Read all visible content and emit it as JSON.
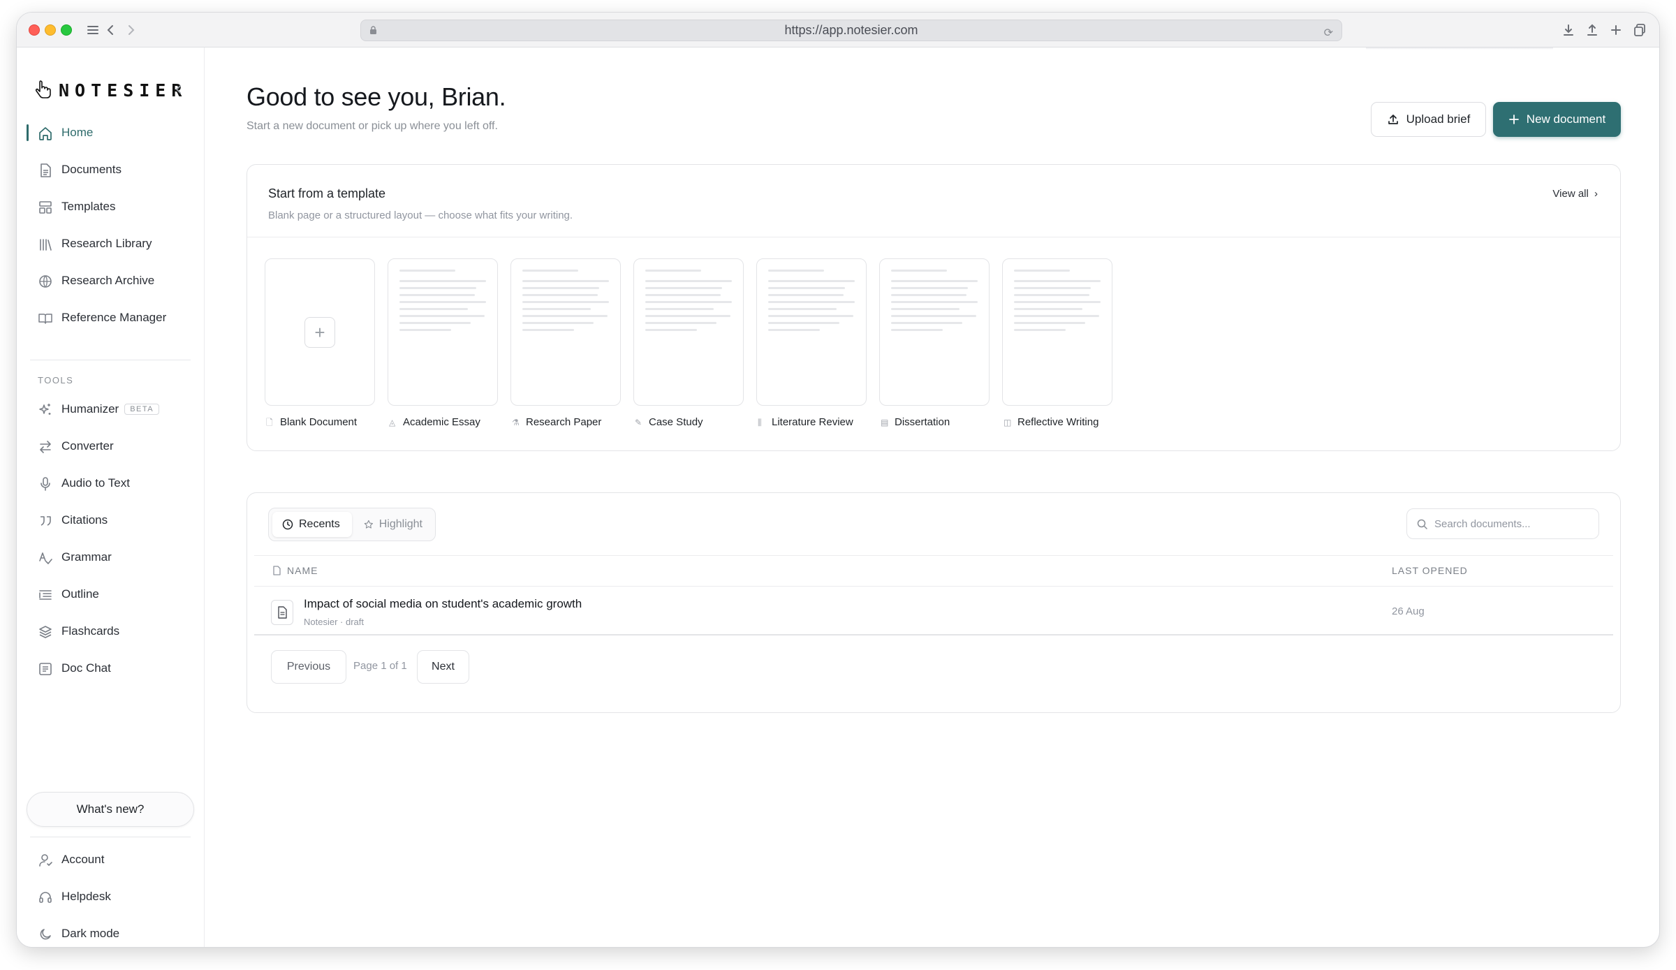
{
  "browser": {
    "url": "https://app.notesier.com"
  },
  "brand": {
    "name": "NOTESIER",
    "accent": "#2e6f72"
  },
  "sidebar": {
    "nav": [
      {
        "label": "Home",
        "icon": "home-icon",
        "active": true
      },
      {
        "label": "Documents",
        "icon": "document-icon"
      },
      {
        "label": "Templates",
        "icon": "templates-icon"
      },
      {
        "label": "Research Library",
        "icon": "library-icon"
      },
      {
        "label": "Research Archive",
        "icon": "globe-icon"
      },
      {
        "label": "Reference Manager",
        "icon": "book-open-icon"
      }
    ],
    "tools_label": "TOOLS",
    "tools": [
      {
        "label": "Humanizer",
        "icon": "sparkles-icon",
        "badge": "BETA"
      },
      {
        "label": "Converter",
        "icon": "arrows-swap-icon"
      },
      {
        "label": "Audio to Text",
        "icon": "microphone-icon"
      },
      {
        "label": "Citations",
        "icon": "quote-icon"
      },
      {
        "label": "Grammar",
        "icon": "spell-check-icon"
      },
      {
        "label": "Outline",
        "icon": "list-indent-icon"
      },
      {
        "label": "Flashcards",
        "icon": "layers-icon"
      },
      {
        "label": "Doc Chat",
        "icon": "chat-icon"
      }
    ],
    "whats_new": "What's new?",
    "bottom": [
      {
        "label": "Account",
        "icon": "user-icon"
      },
      {
        "label": "Helpdesk",
        "icon": "headset-icon"
      },
      {
        "label": "Dark mode",
        "icon": "moon-icon"
      }
    ]
  },
  "header": {
    "greeting": "Good to see you, Brian.",
    "subtitle": "Start a new document or pick up where you left off.",
    "upload_label": "Upload brief",
    "new_label": "New document"
  },
  "templates": {
    "title": "Start from a template",
    "subtitle": "Blank page or a structured layout — choose what fits your writing.",
    "view_all": "View all",
    "items": [
      {
        "label": "Blank Document",
        "icon": "file-icon"
      },
      {
        "label": "Academic Essay",
        "icon": "graduation-cap-icon"
      },
      {
        "label": "Research Paper",
        "icon": "flask-icon"
      },
      {
        "label": "Case Study",
        "icon": "edit-icon"
      },
      {
        "label": "Literature Review",
        "icon": "library-icon"
      },
      {
        "label": "Dissertation",
        "icon": "scroll-icon"
      },
      {
        "label": "Reflective Writing",
        "icon": "book-open-icon"
      }
    ]
  },
  "documents": {
    "tabs": [
      {
        "label": "Recents",
        "icon": "clock-icon",
        "active": true
      },
      {
        "label": "Highlight",
        "icon": "star-icon"
      }
    ],
    "search_placeholder": "Search documents...",
    "columns": {
      "name": "NAME",
      "last_opened": "LAST OPENED"
    },
    "rows": [
      {
        "title": "Impact of social media on student's academic growth",
        "meta": "Notesier · draft",
        "last_opened": "26 Aug"
      }
    ],
    "pagination": {
      "previous": "Previous",
      "info": "Page 1 of 1",
      "next": "Next"
    }
  }
}
